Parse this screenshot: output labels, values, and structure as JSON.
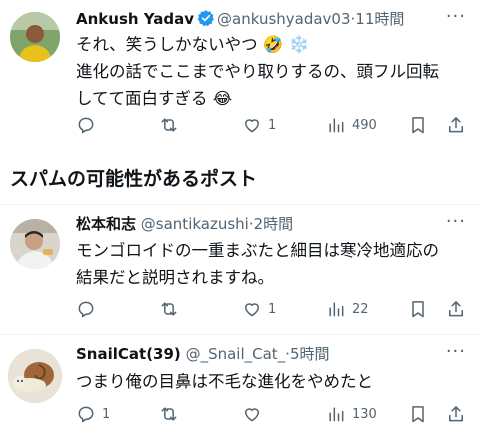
{
  "posts": [
    {
      "name": "Ankush Yadav",
      "verified": true,
      "handle": "@ankushyadav03",
      "time": "11時間",
      "lines": [
        "それ、笑うしかないやつ 🤣 ❄️",
        "進化の話でここまでやり取りするの、頭フル回転",
        "してて面白すぎる 😂"
      ],
      "replies": "",
      "reposts": "",
      "likes": "1",
      "views": "490"
    },
    {
      "name": "松本和志",
      "handle": "@santikazushi",
      "time": "2時間",
      "lines": [
        "モンゴロイドの一重まぶたと細目は寒冷地適応の",
        "結果だと説明されますね。"
      ],
      "replies": "",
      "reposts": "",
      "likes": "1",
      "views": "22"
    },
    {
      "name": "SnailCat(39)",
      "handle": "@_Snail_Cat_",
      "time": "5時間",
      "lines": [
        "つまり俺の目鼻は不毛な進化をやめたと"
      ],
      "replies": "1",
      "reposts": "",
      "likes": "",
      "views": "130"
    }
  ],
  "section_title": "スパムの可能性があるポスト",
  "more_glyph": "···",
  "separator": "·",
  "colors": {
    "verified": "#1d9bf0",
    "muted": "#536471",
    "divider": "#eff3f4"
  },
  "icons": [
    "reply-icon",
    "repost-icon",
    "like-icon",
    "views-icon",
    "bookmark-icon",
    "share-icon"
  ]
}
